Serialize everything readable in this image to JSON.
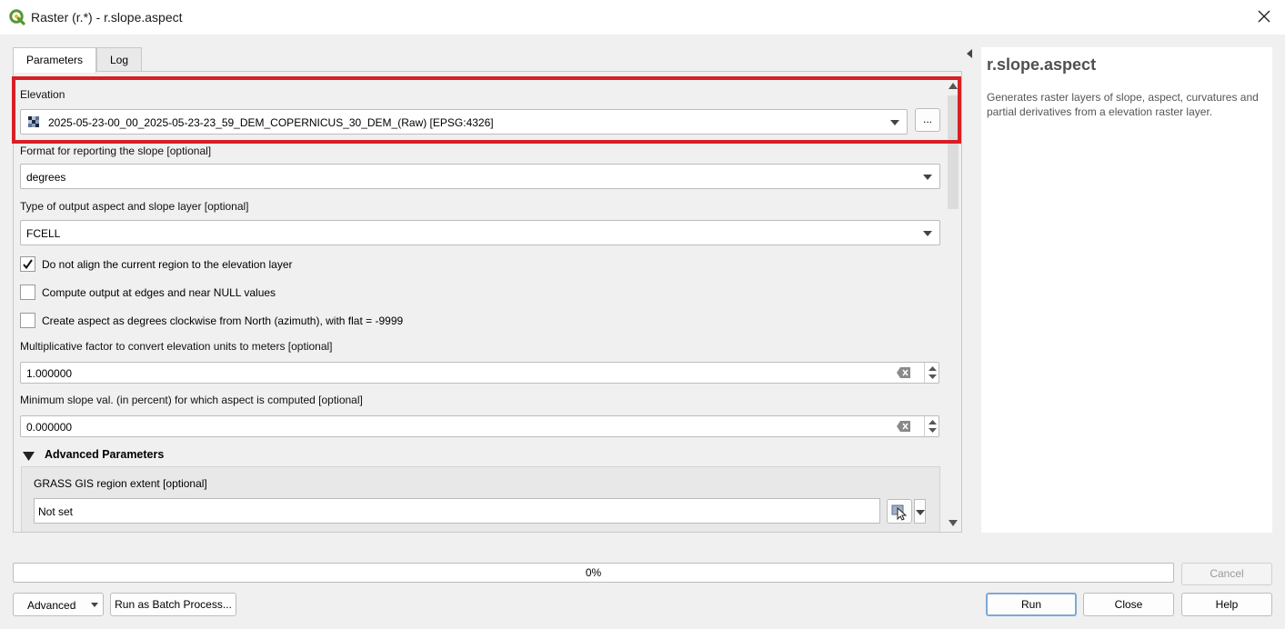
{
  "window": {
    "title": "Raster (r.*) - r.slope.aspect"
  },
  "tabs": [
    {
      "label": "Parameters",
      "active": true
    },
    {
      "label": "Log",
      "active": false
    }
  ],
  "params": {
    "elevation": {
      "label": "Elevation",
      "value": "2025-05-23-00_00_2025-05-23-23_59_DEM_COPERNICUS_30_DEM_(Raw) [EPSG:4326]",
      "browse_label": "..."
    },
    "slope_format": {
      "label": "Format for reporting the slope [optional]",
      "value": "degrees"
    },
    "output_type": {
      "label": "Type of output aspect and slope layer [optional]",
      "value": "FCELL"
    },
    "checkboxes": [
      {
        "label": "Do not align the current region to the elevation layer",
        "checked": true
      },
      {
        "label": "Compute output at edges and near NULL values",
        "checked": false
      },
      {
        "label": "Create aspect as degrees clockwise from North (azimuth), with flat = -9999",
        "checked": false
      }
    ],
    "zscale": {
      "label": "Multiplicative factor to convert elevation units to meters [optional]",
      "value": "1.000000"
    },
    "min_slope": {
      "label": "Minimum slope val. (in percent) for which aspect is computed [optional]",
      "value": "0.000000"
    },
    "advanced_header": "Advanced Parameters",
    "region_extent": {
      "label": "GRASS GIS region extent [optional]",
      "value": "Not set"
    }
  },
  "help": {
    "title": "r.slope.aspect",
    "description": "Generates raster layers of slope, aspect, curvatures and partial derivatives from a elevation raster layer."
  },
  "progress": {
    "text": "0%",
    "value": 0
  },
  "buttons": {
    "advanced": "Advanced",
    "batch": "Run as Batch Process...",
    "cancel": "Cancel",
    "run": "Run",
    "close": "Close",
    "help": "Help"
  },
  "colors": {
    "highlight": "#d91f26",
    "qgis_green": "#589632"
  }
}
